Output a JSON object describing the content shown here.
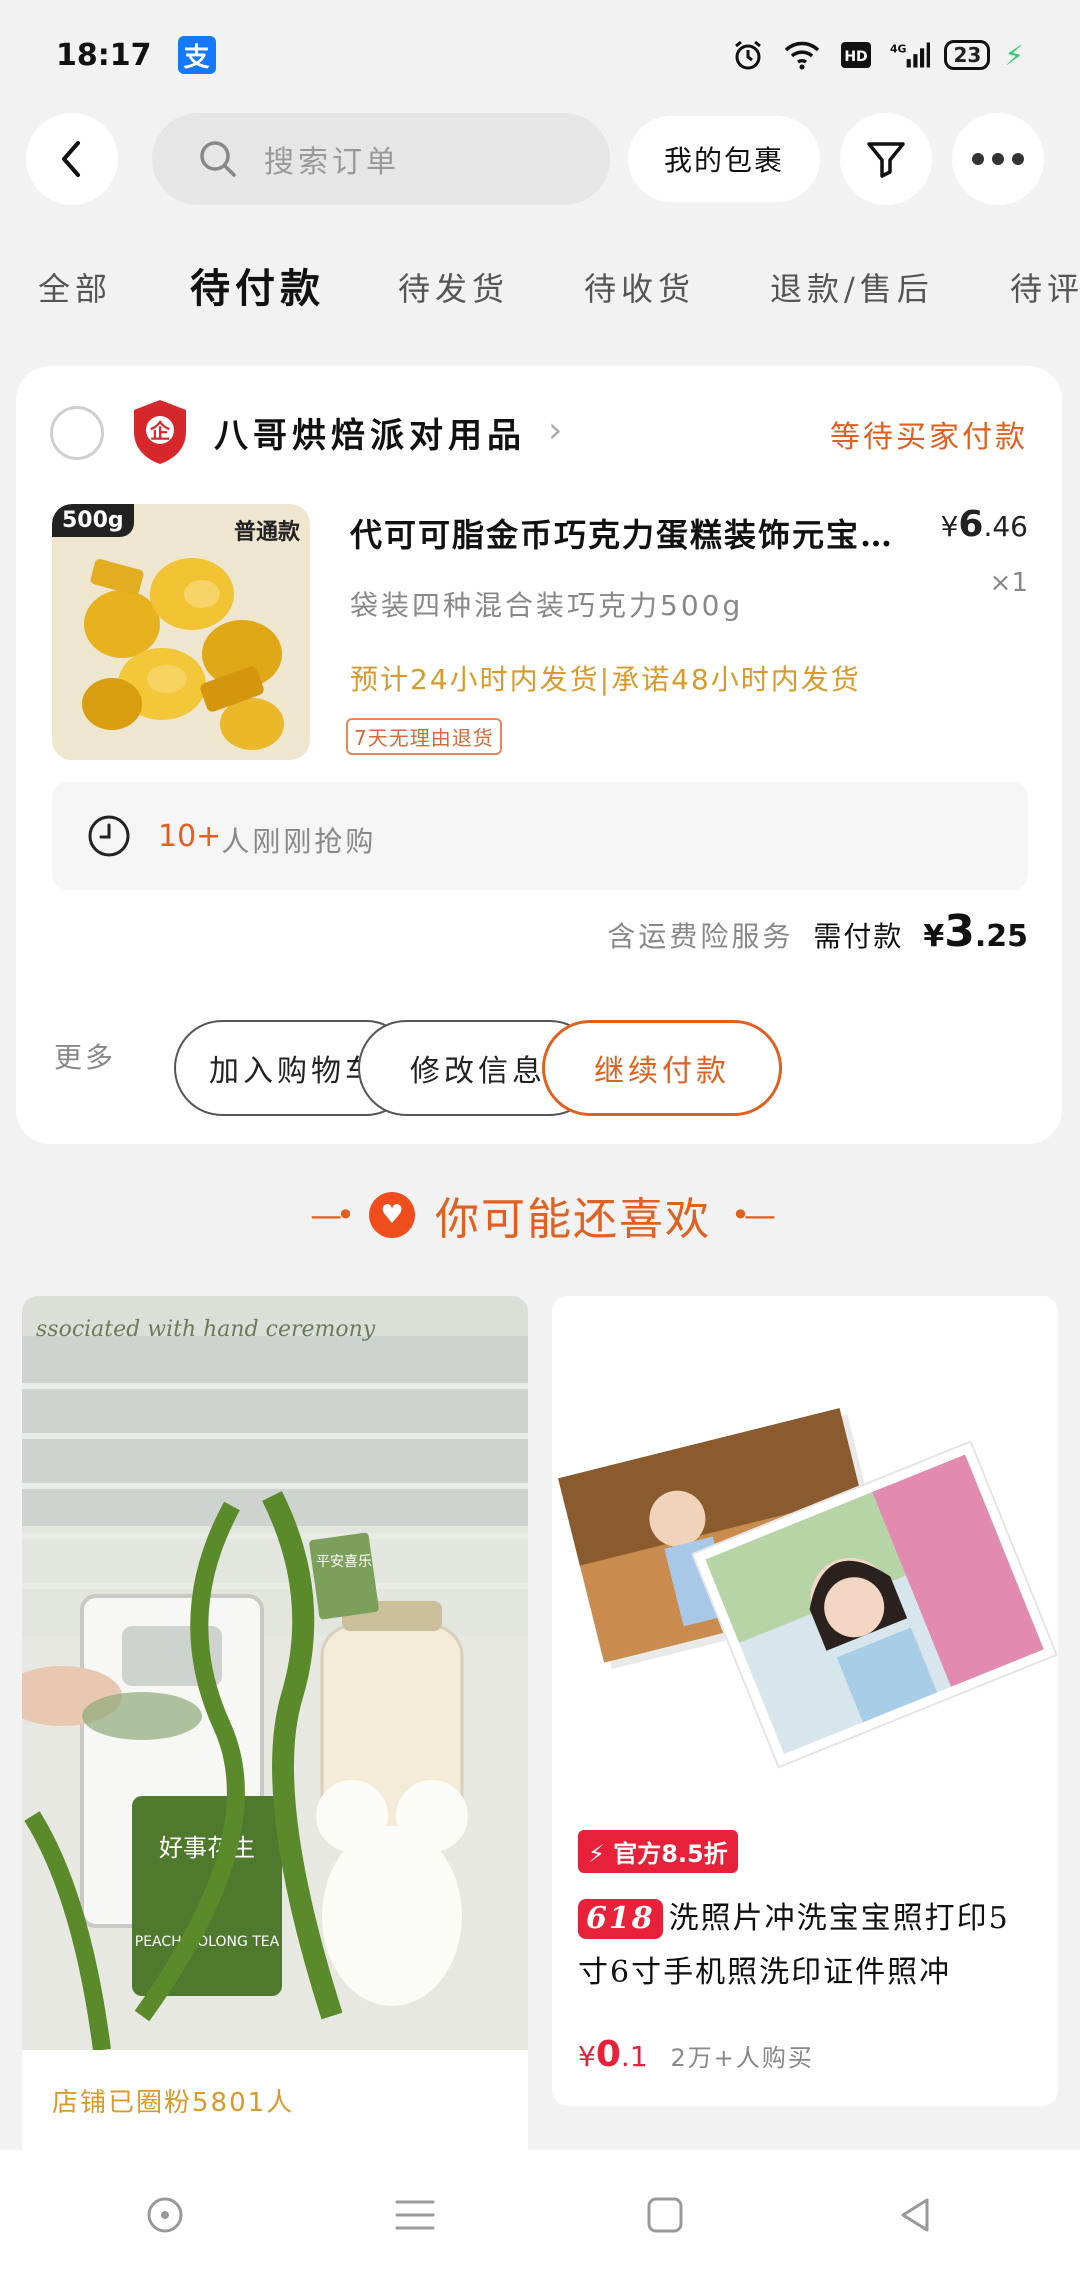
{
  "status_bar": {
    "time": "18:17",
    "alipay_glyph": "支",
    "network": "4G",
    "battery": "23"
  },
  "top_nav": {
    "search_placeholder": "搜索订单",
    "package_label": "我的包裹"
  },
  "tabs": [
    {
      "label": "全部"
    },
    {
      "label": "待付款",
      "active": true
    },
    {
      "label": "待发货"
    },
    {
      "label": "待收货"
    },
    {
      "label": "退款/售后"
    },
    {
      "label": "待评"
    }
  ],
  "order": {
    "shop_name": "八哥烘焙派对用品",
    "status": "等待买家付款",
    "product": {
      "title": "代可可脂金币巧克力蛋糕装饰元宝…",
      "price_symbol": "¥",
      "price_int": "6",
      "price_dec": ".46",
      "qty": "×1",
      "spec": "袋装四种混合装巧克力500g",
      "shipping": "预计24小时内发货|承诺48小时内发货",
      "return_tag": "7天无理由退货",
      "badge_weight": "500g",
      "badge_std": "普通款"
    },
    "grab_count": "10+",
    "grab_text": "人刚刚抢购",
    "total_note": "含运费险服务",
    "total_label": "需付款",
    "total_symbol": "¥",
    "total_int": "3",
    "total_dec": ".25",
    "more": "更多",
    "btn_cart": "加入购物车",
    "btn_edit": "修改信息",
    "btn_pay": "继续付款"
  },
  "recommend": {
    "title": "你可能还喜欢",
    "left_card": {
      "footer": "店铺已圈粉5801人",
      "img_text_top": "ssociated with hand ceremony",
      "img_text_tea": "PEACH OOLONG TEA",
      "img_text_tag": "平安喜乐",
      "img_text_jar": "好事花生"
    },
    "right_card": {
      "sale_tag": "官方8.5折",
      "tag618": "618",
      "title": "洗照片冲洗宝宝照打印5寸6寸手机照洗印证件照冲",
      "price_symbol": "¥",
      "price_int": "0",
      "price_dec": ".1",
      "sold": "2万+人购买"
    }
  },
  "colors": {
    "accent": "#e0601f",
    "red": "#e8213b",
    "ship_orange": "#d99a2b"
  }
}
